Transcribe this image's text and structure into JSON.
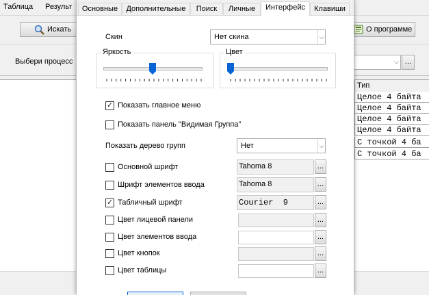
{
  "background_app": {
    "menu": [
      "Таблица",
      "Результ"
    ],
    "search_button": "Искать",
    "about_button": "О программе",
    "process_label": "Выбери процесс",
    "process_dots": "...",
    "grid": {
      "header": "Тип",
      "rows": [
        "Целое 4 байта",
        "Целое 4 байта",
        "Целое 4 байта",
        "Целое 4 байта",
        "С точкой 4 ба",
        "С точкой 4 ба"
      ]
    }
  },
  "dialog": {
    "tabs": [
      {
        "label": "Основные",
        "active": false
      },
      {
        "label": "Дополнительные",
        "active": false
      },
      {
        "label": "Поиск",
        "active": false
      },
      {
        "label": "Личные",
        "active": false
      },
      {
        "label": "Интерфейс",
        "active": true
      },
      {
        "label": "Клавиши",
        "active": false
      }
    ],
    "skin_label": "Скин",
    "skin_value": "Нет скина",
    "brightness_group": "Яркость",
    "brightness_level": 0.5,
    "color_group": "Цвет",
    "color_level": 0.0,
    "checkboxes": [
      {
        "label": "Показать главное меню",
        "checked": true
      },
      {
        "label": "Показать панель \"Видимая Группа\"",
        "checked": false
      }
    ],
    "group_tree_label": "Показать дерево групп",
    "group_tree_value": "Нет",
    "font_rows": [
      {
        "label": "Основной шрифт",
        "checked": false,
        "value": "Tahoma 8",
        "button": "..."
      },
      {
        "label": "Шрифт элементов ввода",
        "checked": false,
        "value": "Tahoma 8",
        "button": "..."
      },
      {
        "label": "Табличный шрифт",
        "checked": true,
        "value": "Courier  9",
        "button": "..."
      }
    ],
    "color_rows": [
      {
        "label": "Цвет лицевой панели",
        "checked": false,
        "button": "..."
      },
      {
        "label": "Цвет элементов ввода",
        "checked": false,
        "button": "..."
      },
      {
        "label": "Цвет кнопок",
        "checked": false,
        "button": "..."
      },
      {
        "label": "Цвет таблицы",
        "checked": false,
        "button": "..."
      }
    ],
    "colors": {
      "accent": "#0a64d6",
      "check": "#222222"
    }
  }
}
